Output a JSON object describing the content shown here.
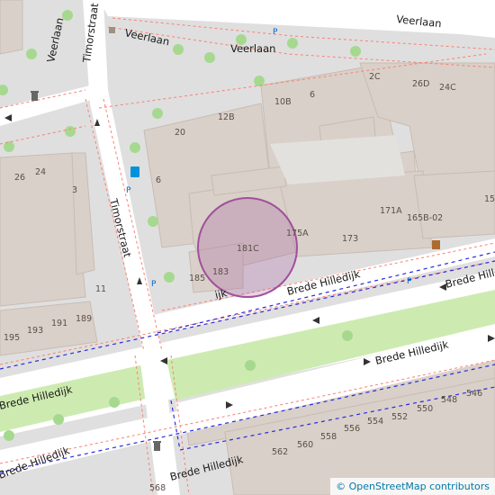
{
  "map": {
    "streets": {
      "veerlaan_top": "Veerlaan",
      "veerlaan_mid": "Veerlaan",
      "veerlaan_left_upper": "Veerlaan",
      "veerlaan_left": "Veerlaan",
      "timorstraat_top": "Timorstraat",
      "timorstraat_mid": "Timorstraat",
      "brede_hilledijk_upper_right": "Brede Hilledijk",
      "brede_hilledijk_upper_mid": "Brede Hilledijk",
      "brede_hilledijk_partial": "ijk",
      "brede_hilledijk_main_left": "Brede Hilledijk",
      "brede_hilledijk_main_mid": "Brede Hilledijk",
      "brede_hilledijk_lower_left": "Brede Hilledijk",
      "brede_hilledijk_lower_mid": "Brede Hilledijk"
    },
    "house_numbers": [
      "2C",
      "26D",
      "24C",
      "10B",
      "6",
      "12B",
      "20",
      "6",
      "171A",
      "165B-02",
      "15",
      "175A",
      "173",
      "181C",
      "183",
      "185",
      "26",
      "24",
      "3",
      "11",
      "189",
      "191",
      "193",
      "195",
      "548",
      "546",
      "550",
      "552",
      "554",
      "556",
      "558",
      "560",
      "562",
      "568"
    ],
    "parking": "P",
    "highlight_color": "#a0509a"
  },
  "attribution": {
    "copyright": "©",
    "text": " OpenStreetMap contributors"
  }
}
